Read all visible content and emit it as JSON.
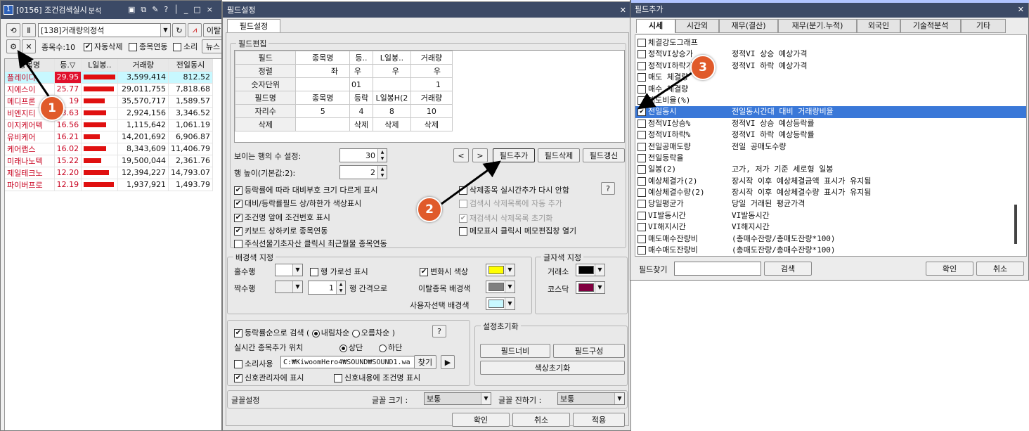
{
  "left_window": {
    "title": "[0156] 조건검색실시",
    "tb_extra": "분석",
    "win_num": "1",
    "condition": "[138]거래량의정석",
    "extra_btn": "이탈",
    "count_label": "종목수:10",
    "auto_delete": "자동삭제",
    "stock_link": "종목연동",
    "sound": "소리",
    "news": "뉴스",
    "headers": [
      "종목명",
      "등.▽",
      "L일봉..",
      "거래량",
      "전일동시"
    ],
    "rows": [
      {
        "name": "플레이디",
        "rate": "29.95",
        "vol": "3,599,414",
        "prev": "812.52",
        "bar": 1.0
      },
      {
        "name": "지에스이",
        "rate": "25.77",
        "vol": "29,011,755",
        "prev": "7,818.68",
        "bar": 0.95
      },
      {
        "name": "메디프론",
        "rate": "19",
        "vol": "35,570,717",
        "prev": "1,589.57",
        "bar": 0.65
      },
      {
        "name": "비엔지티",
        "rate": "3.63",
        "vol": "2,924,156",
        "prev": "3,346.52",
        "bar": 0.7
      },
      {
        "name": "이지케어텍",
        "rate": "16.56",
        "vol": "1,115,642",
        "prev": "1,061.19",
        "bar": 0.7
      },
      {
        "name": "유비케어",
        "rate": "16.21",
        "vol": "14,201,692",
        "prev": "6,906.87",
        "bar": 0.5
      },
      {
        "name": "케어랩스",
        "rate": "16.02",
        "vol": "8,343,609",
        "prev": "11,406.79",
        "bar": 0.7
      },
      {
        "name": "미래나노텍",
        "rate": "15.22",
        "vol": "19,500,044",
        "prev": "2,361.76",
        "bar": 0.55
      },
      {
        "name": "제일테크노",
        "rate": "12.20",
        "vol": "12,394,227",
        "prev": "14,793.07",
        "bar": 0.8
      },
      {
        "name": "파이버프로",
        "rate": "12.19",
        "vol": "1,937,921",
        "prev": "1,493.79",
        "bar": 0.95
      }
    ]
  },
  "field_settings": {
    "title": "필드설정",
    "tab": "필드설정",
    "group_edit": "필드편집",
    "grid_rows": [
      [
        "필드",
        "종목명",
        "등..",
        "L일봉..",
        "거래량"
      ],
      [
        "정렬",
        "좌",
        "우",
        "우",
        "우"
      ],
      [
        "숫자단위",
        "",
        "01",
        "",
        "1"
      ],
      [
        "필드명",
        "종목명",
        "등락",
        "L일봉H(2",
        "거래량"
      ],
      [
        "자리수",
        "5",
        "4",
        "8",
        "10"
      ],
      [
        "삭제",
        "",
        "삭제",
        "삭제",
        "삭제"
      ]
    ],
    "visible_rows_label": "보이는 행의 수 설정:",
    "visible_rows": "30",
    "row_height_label": "행 높이(기본값:2):",
    "row_height": "2",
    "nav_prev": "<",
    "nav_next": ">",
    "add_field": "필드추가",
    "del_field": "필드삭제",
    "refresh_field": "필드갱신",
    "opt1": "등락률에 따라 대비부호 크기 다르게 표시",
    "opt2": "대비/등락률필드 상/하한가 색상표시",
    "opt3": "조건명 앞에 조건번호 표시",
    "opt4": "키보드 상하키로 종목연동",
    "opt5": "주식선물기초자산 클릭시 최근월물 종목연동",
    "ropt1": "삭제종목 실시간추가 다시 안함",
    "ropt2": "검색시 삭제목록에 자동 추가",
    "ropt3": "재검색시 삭제목록 초기화",
    "ropt4": "메모표시 클릭시 메모편집창 열기",
    "bg_group": "배경색 지정",
    "odd_row": "홀수행",
    "even_row": "짝수행",
    "row_lines": "행 가로선 표시",
    "row_interval": "1",
    "interval_label": "행 간격으로",
    "change_color": "변화시 색상",
    "exit_bg": "이탈종목 배경색",
    "user_bg": "사용자선택 배경색",
    "font_color_group": "글자색 지정",
    "kospi": "거래소",
    "kosdaq": "코스닥",
    "sort_search": "등락률순으로 검색",
    "paren_open": "(",
    "paren_close": ")",
    "desc": "내림차순",
    "asc": "오름차순",
    "realtime_pos": "실시간 종목추가 위치",
    "top": "상단",
    "bottom": "하단",
    "sound_use": "소리사용",
    "sound_path": "C:₩KiwoomHero4₩SOUND₩SOUND1.wa",
    "find": "찾기",
    "play": "▶",
    "signal_show": "신호관리자에 표시",
    "signal_cond": "신호내용에 조건명 표시",
    "reset_group": "설정초기화",
    "reset_width": "필드너비",
    "reset_config": "필드구성",
    "reset_color": "색상초기화",
    "font_group": "글꼴설정",
    "font_size_label": "글꼴 크기 :",
    "font_size": "보통",
    "font_dark_label": "글꼴 진하기 :",
    "font_dark": "보통",
    "ok": "확인",
    "cancel": "취소",
    "apply": "적용"
  },
  "field_add": {
    "title": "필드추가",
    "tabs": [
      "시세",
      "시간외",
      "재무(결산)",
      "재무(분기.누적)",
      "외국인",
      "기술적분석",
      "기타"
    ],
    "items": [
      {
        "name": "체결강도그래프",
        "desc": "",
        "checked": false
      },
      {
        "name": "정적VI상승가",
        "desc": "정적VI 상승 예상가격",
        "checked": false
      },
      {
        "name": "정적VI하락가",
        "desc": "정적VI 하락 예상가격",
        "checked": false
      },
      {
        "name": "매도 체결량",
        "desc": "",
        "checked": false
      },
      {
        "name": "매수 체결량",
        "desc": "",
        "checked": false
      },
      {
        "name": "매도비율(%)",
        "desc": "",
        "checked": false
      },
      {
        "name": "전일동시",
        "desc": "전일동시간대 대비 거래량비율",
        "checked": true,
        "sel": true
      },
      {
        "name": "정적VI상승%",
        "desc": "정적VI 상승 예상등락률",
        "checked": false
      },
      {
        "name": "정적VI하락%",
        "desc": "정적VI 하락 예상등락률",
        "checked": false
      },
      {
        "name": "전일공매도량",
        "desc": "전일 공매도수량",
        "checked": false
      },
      {
        "name": "전일등락율",
        "desc": "",
        "checked": false
      },
      {
        "name": "일봉(2)",
        "desc": "고가, 저가 기준 세로형 일봉",
        "checked": false
      },
      {
        "name": "예상체결가(2)",
        "desc": "장시작 이후 예상체결금액 표시가 유지됨",
        "checked": false
      },
      {
        "name": "예상체결수량(2)",
        "desc": "장시작 이후 예상체결수량 표시가 유지됨",
        "checked": false
      },
      {
        "name": "당일평균가",
        "desc": "당일 거래된 평균가격",
        "checked": false
      },
      {
        "name": "VI발동시간",
        "desc": "VI발동시간",
        "checked": false
      },
      {
        "name": "VI해지시간",
        "desc": "VI해지시간",
        "checked": false
      },
      {
        "name": "매도매수잔량비",
        "desc": "(총매수잔량/총매도잔량*100)",
        "checked": false
      },
      {
        "name": "매수매도잔량비",
        "desc": "(총매도잔량/총매수잔량*100)",
        "checked": false
      }
    ],
    "search_label": "필드찾기",
    "search_btn": "검색",
    "ok": "확인",
    "cancel": "취소"
  },
  "annotations": [
    "1",
    "2",
    "3"
  ],
  "colors": {
    "title_bar": "#3c4a66",
    "up_red": "#c8001e",
    "selection": "#3a78d8",
    "change_color": "#ffff00",
    "exit_bg": "#808080",
    "user_bg": "#c8f8ff",
    "kospi_color": "#000000",
    "kosdaq_color": "#800040",
    "annotation": "#e05a2a"
  }
}
